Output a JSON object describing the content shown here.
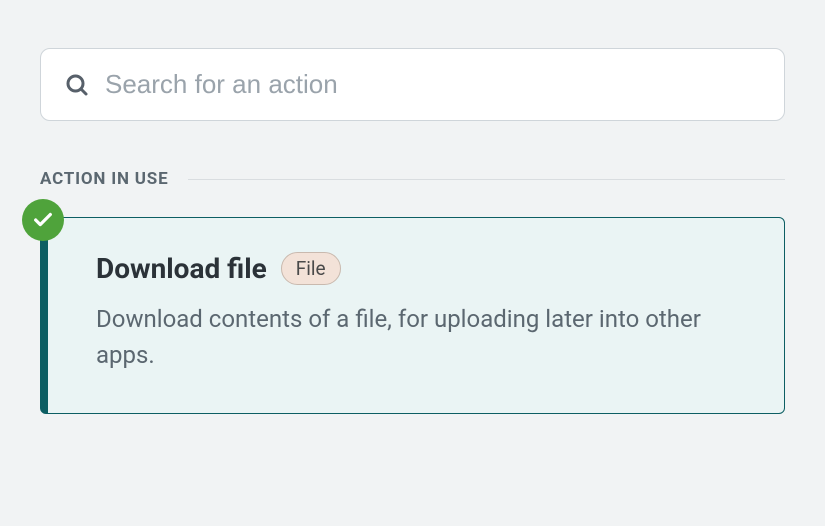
{
  "search": {
    "placeholder": "Search for an action",
    "value": ""
  },
  "section": {
    "label": "ACTION IN USE"
  },
  "action": {
    "title": "Download file",
    "tag": "File",
    "description": "Download contents of a file, for uploading later into other apps."
  }
}
